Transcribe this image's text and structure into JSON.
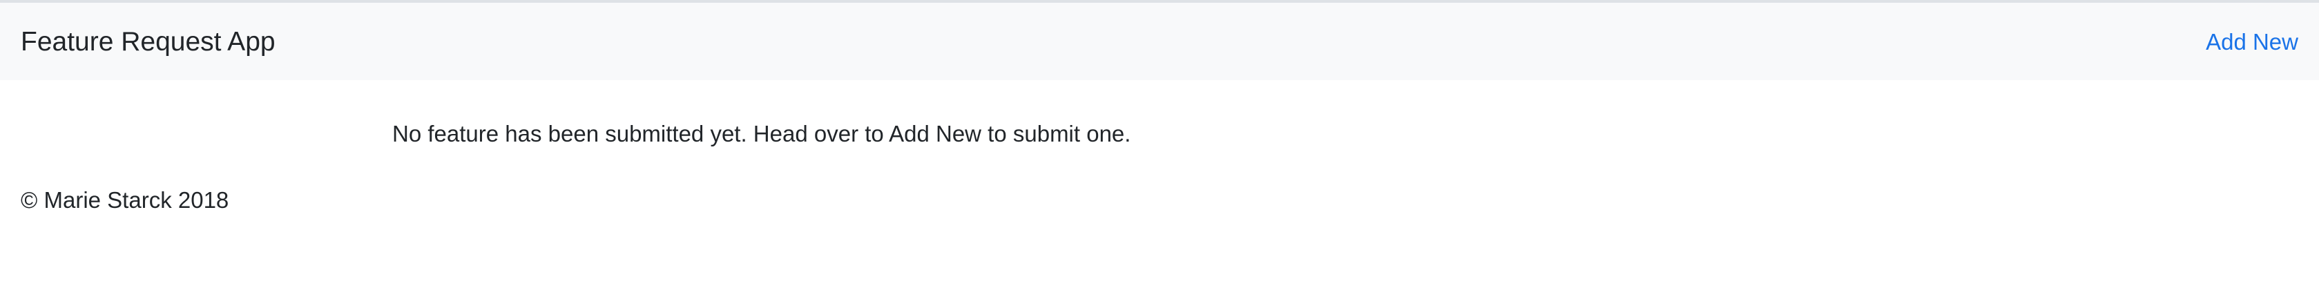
{
  "navbar": {
    "brand": "Feature Request App",
    "add_new_label": "Add New"
  },
  "main": {
    "empty_message": "No feature has been submitted yet. Head over to Add New to submit one."
  },
  "footer": {
    "copyright": "© Marie Starck 2018"
  },
  "colors": {
    "navbar_background": "#f8f9fa",
    "link": "#1a73e8",
    "text": "#212529"
  }
}
